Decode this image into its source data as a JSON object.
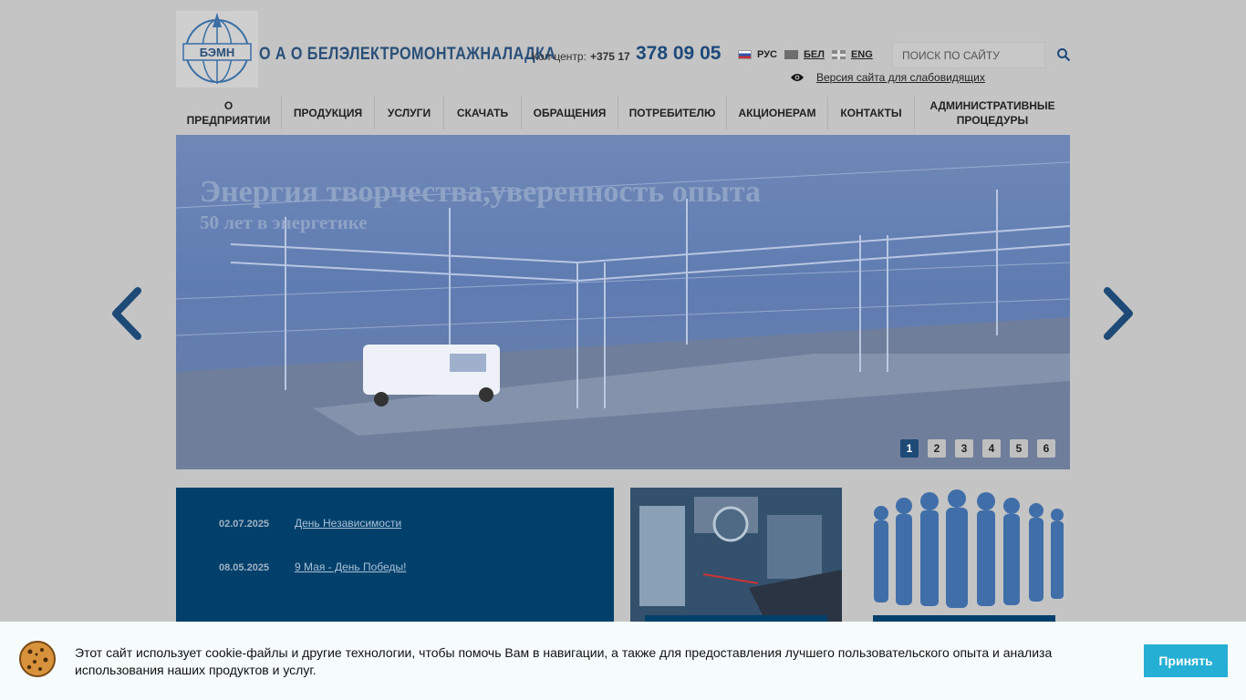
{
  "header": {
    "logo_text": "БЭМН",
    "company_name": "О А О  БЕЛЭЛЕКТРОМОНТАЖНАЛАДКА",
    "callcenter_label": "Кол-центр:",
    "callcenter_code": "+375 17",
    "phone": "378 09 05",
    "languages": [
      {
        "label": "РУС",
        "flag": "russia-flag-icon",
        "active": true
      },
      {
        "label": "БЕЛ",
        "flag": "belarus-flag-icon",
        "active": false
      },
      {
        "label": "ENG",
        "flag": "uk-flag-icon",
        "active": false
      }
    ],
    "search_placeholder": "ПОИСК ПО САЙТУ",
    "accessible_version": "Версия сайта для слабовидящих"
  },
  "nav": {
    "items": [
      {
        "label": "О\nПРЕДПРИЯТИИ"
      },
      {
        "label": "ПРОДУКЦИЯ"
      },
      {
        "label": "УСЛУГИ"
      },
      {
        "label": "СКАЧАТЬ"
      },
      {
        "label": "ОБРАЩЕНИЯ"
      },
      {
        "label": "ПОТРЕБИТЕЛЮ"
      },
      {
        "label": "АКЦИОНЕРАМ"
      },
      {
        "label": "КОНТАКТЫ"
      },
      {
        "label": "АДМИНИСТРАТИВНЫЕ\nПРОЦЕДУРЫ"
      }
    ]
  },
  "slider": {
    "title": "Энергия творчества,уверенность опыта",
    "subtitle": "50 лет в энергетике",
    "pages": [
      "1",
      "2",
      "3",
      "4",
      "5",
      "6"
    ],
    "active_page": 1
  },
  "news": {
    "items": [
      {
        "date": "02.07.2025",
        "title": "День Независимости"
      },
      {
        "date": "08.05.2025",
        "title": "9 Мая - День Победы!"
      }
    ]
  },
  "cookie": {
    "text": "Этот сайт использует cookie-файлы и другие технологии, чтобы помочь Вам в навигации, а также для предоставления лучшего пользовательского опыта и анализа использования наших продуктов и услуг.",
    "accept_label": "Принять"
  },
  "colors": {
    "brand_blue": "#1d4a7a",
    "news_bg": "#02406c",
    "accept_button": "#26afd4",
    "overlay": "#c4c4c4"
  }
}
